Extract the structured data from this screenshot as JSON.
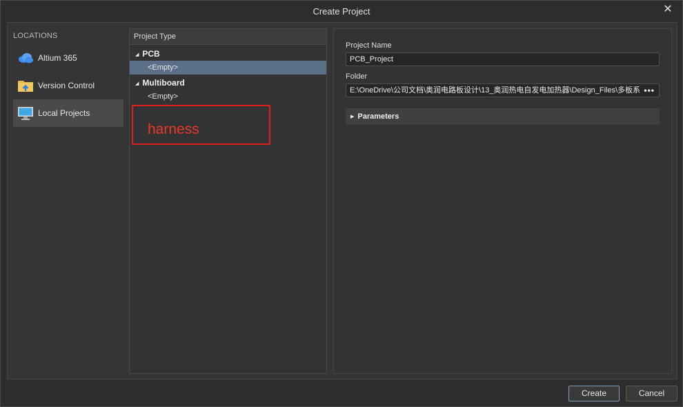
{
  "window": {
    "title": "Create Project",
    "close_glyph": "✕"
  },
  "locations": {
    "heading": "LOCATIONS",
    "items": [
      {
        "label": "Altium 365",
        "icon": "cloud-icon",
        "selected": false
      },
      {
        "label": "Version Control",
        "icon": "version-folder-icon",
        "selected": false
      },
      {
        "label": "Local Projects",
        "icon": "monitor-icon",
        "selected": true
      }
    ]
  },
  "project_type": {
    "header": "Project Type",
    "groups": [
      {
        "label": "PCB",
        "items": [
          {
            "label": "<Empty>",
            "selected": true
          }
        ]
      },
      {
        "label": "Multiboard",
        "items": [
          {
            "label": "<Empty>",
            "selected": false
          }
        ]
      }
    ],
    "annotation": {
      "text": "harness",
      "color": "#e02020"
    }
  },
  "details": {
    "name_label": "Project Name",
    "name_value": "PCB_Project",
    "folder_label": "Folder",
    "folder_value": "E:\\OneDrive\\公司文档\\奥润电路板设计\\13_奥润热电自发电加热器\\Design_Files\\多板系",
    "browse_label": "•••",
    "parameters_label": "Parameters"
  },
  "footer": {
    "create_label": "Create",
    "cancel_label": "Cancel"
  },
  "colors": {
    "selection": "#5a6f87",
    "accent_border": "#7f9bb8",
    "annotation": "#e02020"
  }
}
